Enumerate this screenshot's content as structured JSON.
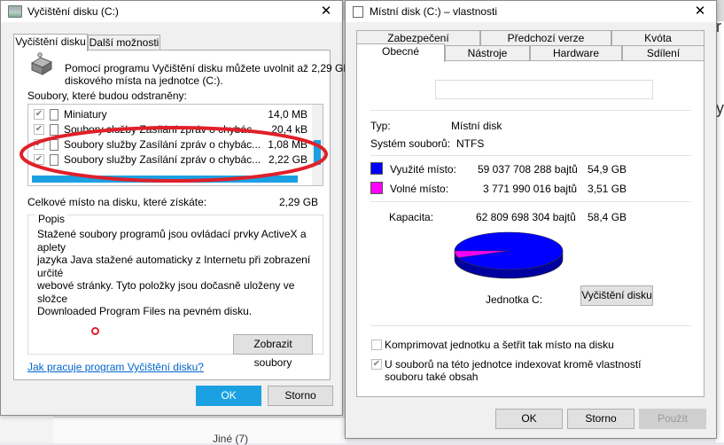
{
  "background": {
    "tree_item": "Jiné (7)",
    "right_letters": [
      "r",
      "y"
    ]
  },
  "cleanup": {
    "title": "Vyčištění disku  (C:)",
    "tabs": [
      {
        "label": "Vyčištění disku"
      },
      {
        "label": "Další možnosti"
      }
    ],
    "intro_line1": "Pomocí programu Vyčištění disku můžete uvolnit až 2,29 GB",
    "intro_line2": "diskového místa na jednotce  (C:).",
    "files_label": "Soubory, které budou odstraněny:",
    "items": [
      {
        "name": "Miniatury",
        "size": "14,0 MB",
        "checked": true
      },
      {
        "name": "Soubory služby Zasílání zpráv o chybác...",
        "size": "20,4 kB",
        "checked": true
      },
      {
        "name": "Soubory služby Zasílání zpráv o chybác...",
        "size": "1,08 MB",
        "checked": true
      },
      {
        "name": "Soubory služby Zasílání zpráv o chybác...",
        "size": "2,22 GB",
        "checked": true
      }
    ],
    "total_label": "Celkové místo na disku, které získáte:",
    "total_value": "2,29 GB",
    "description_title": "Popis",
    "description_lines": [
      "Stažené soubory programů jsou ovládací prvky ActiveX a aplety",
      "jazyka Java stažené automaticky z Internetu při zobrazení určité",
      "webové stránky. Tyto položky jsou dočasně uloženy ve složce",
      "Downloaded Program Files na pevném disku."
    ],
    "view_files_button": "Zobrazit soubory",
    "help_link": "Jak pracuje program Vyčištění disku?",
    "ok_button": "OK",
    "cancel_button": "Storno",
    "annotation_color": "#e0202a",
    "accent_color": "#1ba1e2"
  },
  "props": {
    "title": "Místní disk (C:) – vlastnosti",
    "tabs_row1": [
      {
        "label": "Zabezpečení"
      },
      {
        "label": "Předchozí verze"
      },
      {
        "label": "Kvóta"
      }
    ],
    "tabs_row2": [
      {
        "label": "Obecné"
      },
      {
        "label": "Nástroje"
      },
      {
        "label": "Hardware"
      },
      {
        "label": "Sdílení"
      }
    ],
    "name_value": "",
    "type_label": "Typ:",
    "type_value": "Místní disk",
    "fs_label": "Systém souborů:",
    "fs_value": "NTFS",
    "used_label": "Využité místo:",
    "used_bytes": "59 037 708 288 bajtů",
    "used_gb": "54,9 GB",
    "used_color": "#0000ff",
    "free_label": "Volné místo:",
    "free_bytes": "3 771 990 016 bajtů",
    "free_gb": "3,51 GB",
    "free_color": "#ff00ff",
    "capacity_label": "Kapacita:",
    "capacity_bytes": "62 809 698 304 bajtů",
    "capacity_gb": "58,4 GB",
    "used_fraction": 0.94,
    "drive_label": "Jednotka C:",
    "cleanup_button": "Vyčištění disku",
    "compress_label": "Komprimovat jednotku a šetřit tak místo na disku",
    "compress_checked": false,
    "index_label_line1": "U souborů na této jednotce indexovat kromě vlastností",
    "index_label_line2": "souboru také obsah",
    "index_checked": true,
    "ok_button": "OK",
    "cancel_button": "Storno",
    "apply_button": "Použít"
  }
}
